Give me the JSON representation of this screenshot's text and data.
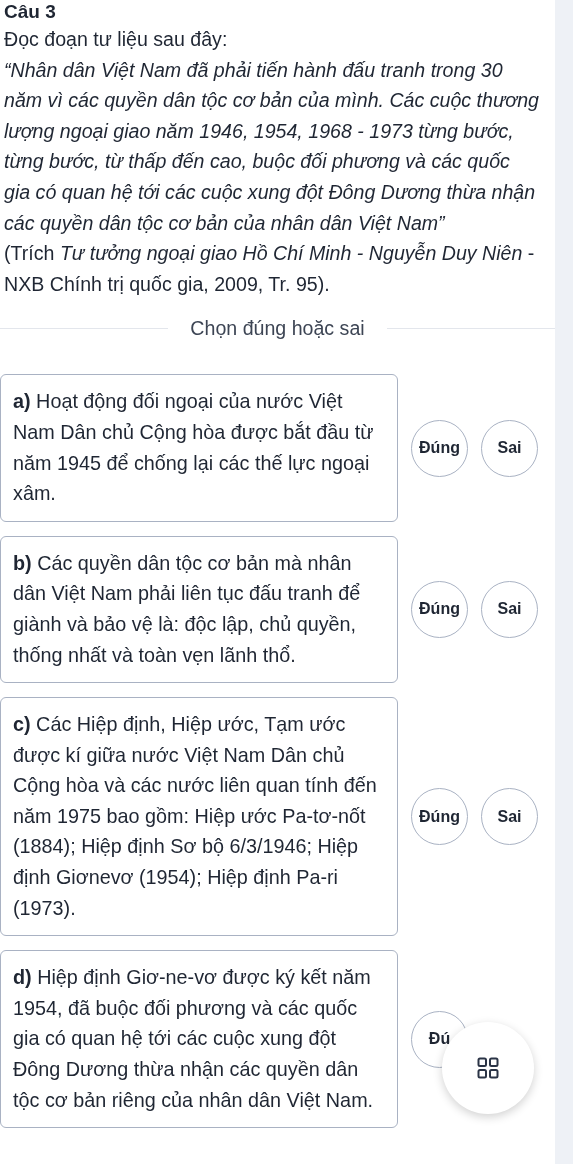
{
  "question": {
    "title": "Câu 3",
    "intro": "Đọc đoạn tư liệu sau đây:",
    "quote": "“Nhân dân Việt Nam đã phải tiến hành đấu tranh trong 30 năm vì các quyền dân tộc cơ bản của mình. Các cuộc thương lượng ngoại giao năm 1946, 1954, 1968 - 1973 từng bước, từng bước, từ thấp đến cao, buộc đối phương và các quốc gia có quan hệ tới các cuộc xung đột Đông Dương thừa nhận các quyền dân tộc cơ bản của nhân dân Việt Nam”",
    "source": "(Trích *Tư tưởng ngoại giao Hồ Chí Minh - Nguyễn Duy Niên* - NXB Chính trị quốc gia, 2009, Tr. 95)."
  },
  "section_title": "Chọn đúng hoặc sai",
  "statements": [
    {
      "label": "a)",
      "text": "Hoạt động đối ngoại của nước Việt Nam Dân chủ Cộng hòa được bắt đầu từ năm 1945 để chống lại các thế lực ngoại xâm.",
      "options": [
        {
          "text": "Đúng",
          "selected": false
        },
        {
          "text": "Sai",
          "selected": false
        }
      ]
    },
    {
      "label": "b)",
      "text": "Các quyền dân tộc cơ bản mà nhân dân Việt Nam phải liên tục đấu tranh để giành và bảo vệ là: độc lập, chủ quyền, thống nhất và toàn vẹn lãnh thổ.",
      "options": [
        {
          "text": "Đúng",
          "selected": false
        },
        {
          "text": "Sai",
          "selected": false
        }
      ]
    },
    {
      "label": "c)",
      "text": "Các Hiệp định, Hiệp ước, Tạm ước được kí giữa nước Việt Nam Dân chủ Cộng hòa và các nước liên quan tính đến năm 1975 bao gồm: Hiệp ước Pa-tơ-nốt (1884); Hiệp định Sơ bộ 6/3/1946; Hiệp định Giơnevơ (1954); Hiệp định Pa-ri (1973).",
      "options": [
        {
          "text": "Đúng",
          "selected": false
        },
        {
          "text": "Sai",
          "selected": false
        }
      ]
    },
    {
      "label": "d)",
      "text": "Hiệp định Giơ-ne-vơ được ký kết năm 1954, đã buộc đối phương và các quốc gia có quan hệ tới các cuộc xung đột Đông Dương thừa nhận các quyền dân tộc cơ bản riêng của nhân dân Việt Nam.",
      "options": [
        {
          "text": "Đú",
          "selected": false
        }
      ]
    }
  ],
  "floating_button": {
    "kind": "grid"
  }
}
